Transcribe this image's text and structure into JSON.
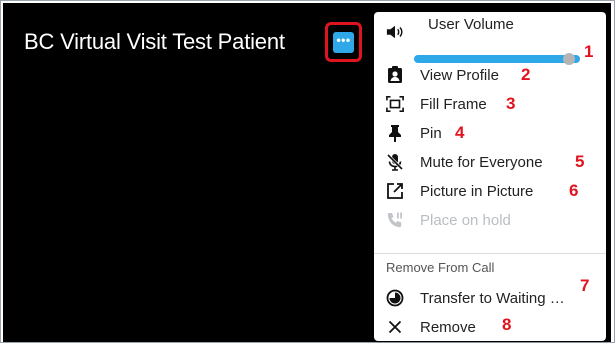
{
  "video": {
    "participant_name": "BC Virtual Visit Test Patient",
    "more_button_glyph": "•••"
  },
  "menu": {
    "volume": {
      "label": "User Volume",
      "level": 0.97,
      "callout": "1"
    },
    "items": [
      {
        "label": "View Profile",
        "icon": "profile-badge-icon",
        "callout": "2",
        "enabled": true
      },
      {
        "label": "Fill Frame",
        "icon": "fill-frame-icon",
        "callout": "3",
        "enabled": true
      },
      {
        "label": "Pin",
        "icon": "pin-icon",
        "callout": "4",
        "enabled": true
      },
      {
        "label": "Mute for Everyone",
        "icon": "mic-off-icon",
        "callout": "5",
        "enabled": true
      },
      {
        "label": "Picture in Picture",
        "icon": "picture-in-picture-icon",
        "callout": "6",
        "enabled": true
      },
      {
        "label": "Place on hold",
        "icon": "phone-hold-icon",
        "callout": "",
        "enabled": false
      }
    ],
    "remove_section": {
      "heading": "Remove From Call",
      "items": [
        {
          "label": "Transfer to Waiting …",
          "icon": "transfer-clock-icon",
          "callout": "7"
        },
        {
          "label": "Remove",
          "icon": "close-icon",
          "callout": "8"
        }
      ]
    }
  },
  "colors": {
    "accent": "#2ea8e8",
    "callout": "#e0141e",
    "disabled": "#b9bec4"
  }
}
